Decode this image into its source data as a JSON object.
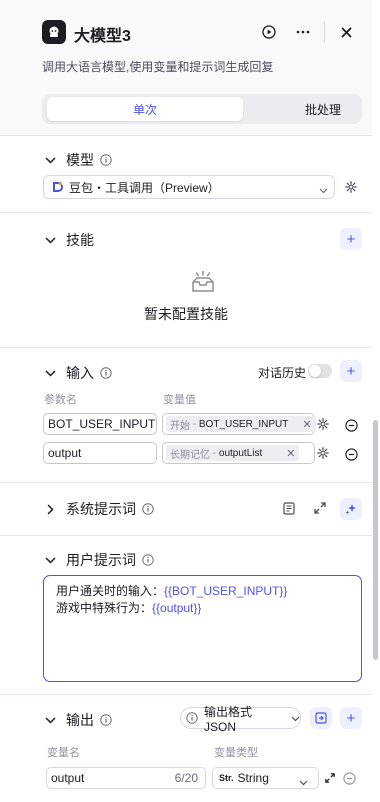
{
  "header": {
    "title": "大模型3",
    "description": "调用大语言模型,使用变量和提示词生成回复",
    "tabs": [
      {
        "label": "单次",
        "active": true
      },
      {
        "label": "批处理",
        "active": false
      }
    ]
  },
  "model_section": {
    "label": "模型",
    "selected_model": "豆包・工具调用（Preview）"
  },
  "skills_section": {
    "label": "技能",
    "empty_text": "暂未配置技能"
  },
  "input_section": {
    "label": "输入",
    "history_label": "对话历史",
    "history_enabled": false,
    "col_name": "参数名",
    "col_value": "变量值",
    "rows": [
      {
        "name": "BOT_USER_INPUT",
        "source": "开始",
        "variable": "BOT_USER_INPUT"
      },
      {
        "name": "output",
        "source": "长期记忆",
        "variable": "outputList"
      }
    ]
  },
  "system_prompt_section": {
    "label": "系统提示词"
  },
  "user_prompt_section": {
    "label": "用户提示词",
    "lines": [
      {
        "text": "用户通关时的输入：",
        "var": "{{BOT_USER_INPUT}}"
      },
      {
        "text": "游戏中特殊行为：",
        "var": "{{output}}"
      }
    ]
  },
  "output_section": {
    "label": "输出",
    "format_label": "输出格式 JSON",
    "col_name": "变量名",
    "col_type": "变量类型",
    "rows": [
      {
        "name": "output",
        "counter": "6/20",
        "type_badge": "Str.",
        "type": "String"
      }
    ]
  },
  "colors": {
    "accent": "#4d53e8",
    "accent_bg": "#eef0ff"
  }
}
